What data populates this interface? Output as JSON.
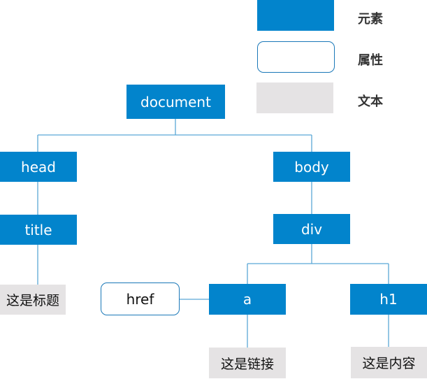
{
  "legend": {
    "element": "元素",
    "attribute": "属性",
    "text": "文本"
  },
  "nodes": {
    "document": "document",
    "head": "head",
    "body": "body",
    "title": "title",
    "div": "div",
    "title_text": "这是标题",
    "href": "href",
    "a": "a",
    "h1": "h1",
    "a_text": "这是链接",
    "h1_text": "这是内容"
  },
  "colors": {
    "element": "#0284cc",
    "attribute_border": "#1a78b8",
    "text": "#e5e3e4",
    "edge": "#5aa7d6"
  }
}
